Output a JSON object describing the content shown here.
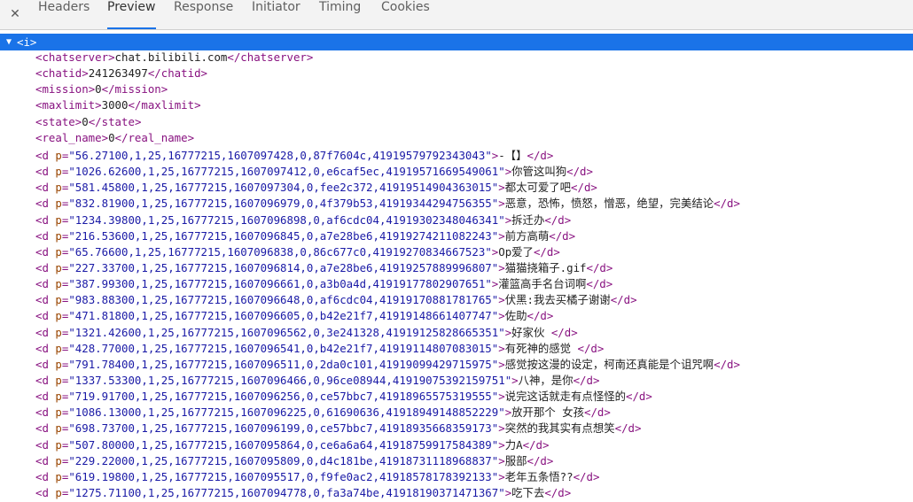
{
  "tabs": {
    "close_glyph": "✕",
    "items": [
      "Headers",
      "Preview",
      "Response",
      "Initiator",
      "Timing",
      "Cookies"
    ],
    "active": "Preview"
  },
  "tree": {
    "root_arrow": "▼",
    "root": "<i>",
    "simple": [
      {
        "tag": "chatserver",
        "value": "chat.bilibili.com"
      },
      {
        "tag": "chatid",
        "value": "241263497"
      },
      {
        "tag": "mission",
        "value": "0"
      },
      {
        "tag": "maxlimit",
        "value": "3000"
      },
      {
        "tag": "state",
        "value": "0"
      },
      {
        "tag": "real_name",
        "value": "0"
      }
    ],
    "danmaku": [
      {
        "p": "56.27100,1,25,16777215,1607097428,0,87f7604c,41919579792343043",
        "text": "-【】"
      },
      {
        "p": "1026.62600,1,25,16777215,1607097412,0,e6caf5ec,41919571669549061",
        "text": "你管这叫狗"
      },
      {
        "p": "581.45800,1,25,16777215,1607097304,0,fee2c372,41919514904363015",
        "text": "都太可爱了吧"
      },
      {
        "p": "832.81900,1,25,16777215,1607096979,0,4f379b53,41919344294756355",
        "text": "恶意，恐怖，愤怒，憎恶，绝望，完美结论"
      },
      {
        "p": "1234.39800,1,25,16777215,1607096898,0,af6cdc04,41919302348046341",
        "text": "拆迁办"
      },
      {
        "p": "216.53600,1,25,16777215,1607096845,0,a7e28be6,41919274211082243",
        "text": "前方高萌"
      },
      {
        "p": "65.76600,1,25,16777215,1607096838,0,86c677c0,41919270834667523",
        "text": "Op爱了"
      },
      {
        "p": "227.33700,1,25,16777215,1607096814,0,a7e28be6,41919257889996807",
        "text": "猫猫挠箱子.gif"
      },
      {
        "p": "387.99300,1,25,16777215,1607096661,0,a3b0a4d,41919177802907651",
        "text": "灌篮高手名台词啊"
      },
      {
        "p": "983.88300,1,25,16777215,1607096648,0,af6cdc04,41919170881781765",
        "text": "伏黑:我去买橘子谢谢"
      },
      {
        "p": "471.81800,1,25,16777215,1607096605,0,b42e21f7,41919148661407747",
        "text": "佐助"
      },
      {
        "p": "1321.42600,1,25,16777215,1607096562,0,3e241328,41919125828665351",
        "text": "好家伙 "
      },
      {
        "p": "428.77000,1,25,16777215,1607096541,0,b42e21f7,41919114807083015",
        "text": "有死神的感觉 "
      },
      {
        "p": "791.78400,1,25,16777215,1607096511,0,2da0c101,41919099429715975",
        "text": "感觉按这漫的设定，柯南还真能是个诅咒啊"
      },
      {
        "p": "1337.53300,1,25,16777215,1607096466,0,96ce08944,41919075392159751",
        "text": "八神，是你"
      },
      {
        "p": "719.91700,1,25,16777215,1607096256,0,ce57bbc7,41918965575319555",
        "text": "说完这话就走有点怪怪的"
      },
      {
        "p": "1086.13000,1,25,16777215,1607096225,0,61690636,41918949148852229",
        "text": "放开那个 女孩"
      },
      {
        "p": "698.73700,1,25,16777215,1607096199,0,ce57bbc7,41918935668359173",
        "text": "突然的我其实有点想笑"
      },
      {
        "p": "507.80000,1,25,16777215,1607095864,0,ce6a6a64,41918759917584389",
        "text": "力A"
      },
      {
        "p": "229.22000,1,25,16777215,1607095809,0,d4c181be,41918731118968837",
        "text": "服部"
      },
      {
        "p": "619.19800,1,25,16777215,1607095517,0,f9fe0ac2,41918578178392133",
        "text": "老年五条悟??"
      },
      {
        "p": "1275.71100,1,25,16777215,1607094778,0,fa3a74be,41918190371471367",
        "text": "吃下去"
      }
    ]
  }
}
